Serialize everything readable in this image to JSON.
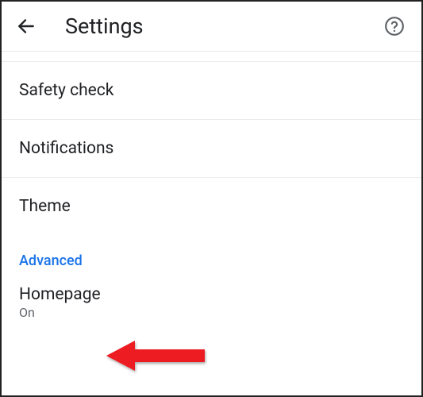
{
  "header": {
    "title": "Settings"
  },
  "items": {
    "safety_check": "Safety check",
    "notifications": "Notifications",
    "theme": "Theme"
  },
  "section": {
    "advanced": "Advanced"
  },
  "homepage": {
    "label": "Homepage",
    "status": "On"
  }
}
